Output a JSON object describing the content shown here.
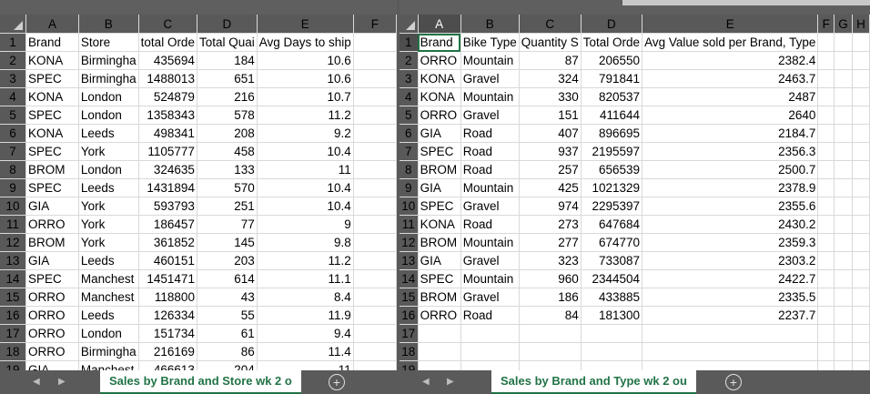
{
  "left_sheet": {
    "columns": [
      "A",
      "B",
      "C",
      "D",
      "E",
      "F"
    ],
    "rows": [
      {
        "n": "1",
        "cells": [
          "Brand",
          "Store",
          "total Orde",
          "Total Quai",
          "Avg Days to ship",
          ""
        ]
      },
      {
        "n": "2",
        "cells": [
          "KONA",
          "Birmingha",
          "435694",
          "184",
          "10.6",
          ""
        ]
      },
      {
        "n": "3",
        "cells": [
          "SPEC",
          "Birmingha",
          "1488013",
          "651",
          "10.6",
          ""
        ]
      },
      {
        "n": "4",
        "cells": [
          "KONA",
          "London",
          "524879",
          "216",
          "10.7",
          ""
        ]
      },
      {
        "n": "5",
        "cells": [
          "SPEC",
          "London",
          "1358343",
          "578",
          "11.2",
          ""
        ]
      },
      {
        "n": "6",
        "cells": [
          "KONA",
          "Leeds",
          "498341",
          "208",
          "9.2",
          ""
        ]
      },
      {
        "n": "7",
        "cells": [
          "SPEC",
          "York",
          "1105777",
          "458",
          "10.4",
          ""
        ]
      },
      {
        "n": "8",
        "cells": [
          "BROM",
          "London",
          "324635",
          "133",
          "11",
          ""
        ]
      },
      {
        "n": "9",
        "cells": [
          "SPEC",
          "Leeds",
          "1431894",
          "570",
          "10.4",
          ""
        ]
      },
      {
        "n": "10",
        "cells": [
          "GIA",
          "York",
          "593793",
          "251",
          "10.4",
          ""
        ]
      },
      {
        "n": "11",
        "cells": [
          "ORRO",
          "York",
          "186457",
          "77",
          "9",
          ""
        ]
      },
      {
        "n": "12",
        "cells": [
          "BROM",
          "York",
          "361852",
          "145",
          "9.8",
          ""
        ]
      },
      {
        "n": "13",
        "cells": [
          "GIA",
          "Leeds",
          "460151",
          "203",
          "11.2",
          ""
        ]
      },
      {
        "n": "14",
        "cells": [
          "SPEC",
          "Manchest",
          "1451471",
          "614",
          "11.1",
          ""
        ]
      },
      {
        "n": "15",
        "cells": [
          "ORRO",
          "Manchest",
          "118800",
          "43",
          "8.4",
          ""
        ]
      },
      {
        "n": "16",
        "cells": [
          "ORRO",
          "Leeds",
          "126334",
          "55",
          "11.9",
          ""
        ]
      },
      {
        "n": "17",
        "cells": [
          "ORRO",
          "London",
          "151734",
          "61",
          "9.4",
          ""
        ]
      },
      {
        "n": "18",
        "cells": [
          "ORRO",
          "Birmingha",
          "216169",
          "86",
          "11.4",
          ""
        ]
      },
      {
        "n": "19",
        "cells": [
          "GIA",
          "Manchest",
          "466613",
          "204",
          "11",
          ""
        ]
      }
    ],
    "tab_label": "Sales by Brand and Store wk 2 o"
  },
  "right_sheet": {
    "columns": [
      "A",
      "B",
      "C",
      "D",
      "E",
      "F",
      "G",
      "H"
    ],
    "rows": [
      {
        "n": "1",
        "cells": [
          "Brand",
          "Bike Type",
          "Quantity S",
          "Total Orde",
          "Avg Value sold per Brand, Type",
          "",
          "",
          ""
        ]
      },
      {
        "n": "2",
        "cells": [
          "ORRO",
          "Mountain",
          "87",
          "206550",
          "2382.4",
          "",
          "",
          ""
        ]
      },
      {
        "n": "3",
        "cells": [
          "KONA",
          "Gravel",
          "324",
          "791841",
          "2463.7",
          "",
          "",
          ""
        ]
      },
      {
        "n": "4",
        "cells": [
          "KONA",
          "Mountain",
          "330",
          "820537",
          "2487",
          "",
          "",
          ""
        ]
      },
      {
        "n": "5",
        "cells": [
          "ORRO",
          "Gravel",
          "151",
          "411644",
          "2640",
          "",
          "",
          ""
        ]
      },
      {
        "n": "6",
        "cells": [
          "GIA",
          "Road",
          "407",
          "896695",
          "2184.7",
          "",
          "",
          ""
        ]
      },
      {
        "n": "7",
        "cells": [
          "SPEC",
          "Road",
          "937",
          "2195597",
          "2356.3",
          "",
          "",
          ""
        ]
      },
      {
        "n": "8",
        "cells": [
          "BROM",
          "Road",
          "257",
          "656539",
          "2500.7",
          "",
          "",
          ""
        ]
      },
      {
        "n": "9",
        "cells": [
          "GIA",
          "Mountain",
          "425",
          "1021329",
          "2378.9",
          "",
          "",
          ""
        ]
      },
      {
        "n": "10",
        "cells": [
          "SPEC",
          "Gravel",
          "974",
          "2295397",
          "2355.6",
          "",
          "",
          ""
        ]
      },
      {
        "n": "11",
        "cells": [
          "KONA",
          "Road",
          "273",
          "647684",
          "2430.2",
          "",
          "",
          ""
        ]
      },
      {
        "n": "12",
        "cells": [
          "BROM",
          "Mountain",
          "277",
          "674770",
          "2359.3",
          "",
          "",
          ""
        ]
      },
      {
        "n": "13",
        "cells": [
          "GIA",
          "Gravel",
          "323",
          "733087",
          "2303.2",
          "",
          "",
          ""
        ]
      },
      {
        "n": "14",
        "cells": [
          "SPEC",
          "Mountain",
          "960",
          "2344504",
          "2422.7",
          "",
          "",
          ""
        ]
      },
      {
        "n": "15",
        "cells": [
          "BROM",
          "Gravel",
          "186",
          "433885",
          "2335.5",
          "",
          "",
          ""
        ]
      },
      {
        "n": "16",
        "cells": [
          "ORRO",
          "Road",
          "84",
          "181300",
          "2237.7",
          "",
          "",
          ""
        ]
      },
      {
        "n": "17",
        "cells": [
          "",
          "",
          "",
          "",
          "",
          "",
          "",
          ""
        ]
      },
      {
        "n": "18",
        "cells": [
          "",
          "",
          "",
          "",
          "",
          "",
          "",
          ""
        ]
      },
      {
        "n": "19",
        "cells": [
          "",
          "",
          "",
          "",
          "",
          "",
          "",
          ""
        ]
      }
    ],
    "tab_label": "Sales by Brand and Type wk 2 ou"
  },
  "colors": {
    "accent": "#217346",
    "header_bg": "#595959",
    "header_text": "#ffffff",
    "gridline": "#d9d9d9"
  },
  "icons": {
    "add_sheet": "plus-circle-icon",
    "nav_prev": "triangle-left-icon",
    "nav_next": "triangle-right-icon",
    "select_all": "select-all-triangle-icon"
  }
}
